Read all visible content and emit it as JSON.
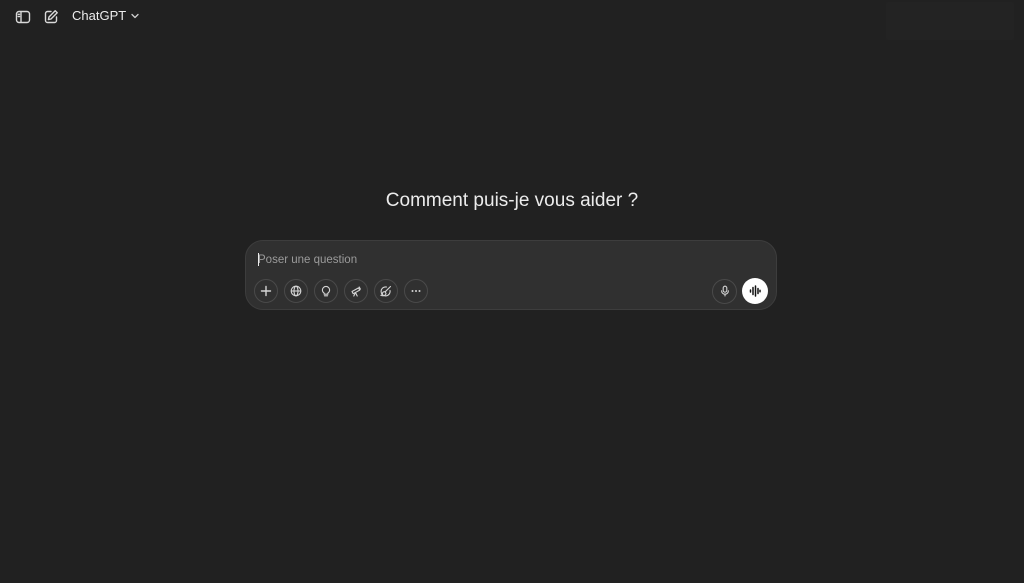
{
  "header": {
    "model_name": "ChatGPT",
    "icons": {
      "sidebar": "sidebar-toggle-icon",
      "new_chat": "new-chat-icon",
      "chevron": "chevron-down-icon"
    }
  },
  "main": {
    "headline": "Comment puis-je vous aider ?"
  },
  "composer": {
    "placeholder": "Poser une question",
    "tools": [
      "plus-icon",
      "globe-icon",
      "lightbulb-icon",
      "telescope-icon",
      "paintbrush-icon",
      "more-icon"
    ],
    "right": [
      "microphone-icon",
      "voice-mode-icon"
    ]
  },
  "colors": {
    "background": "#212121",
    "composer": "#303030",
    "text": "#ececec",
    "muted": "#9b9b9b",
    "voice_button": "#ffffff"
  }
}
